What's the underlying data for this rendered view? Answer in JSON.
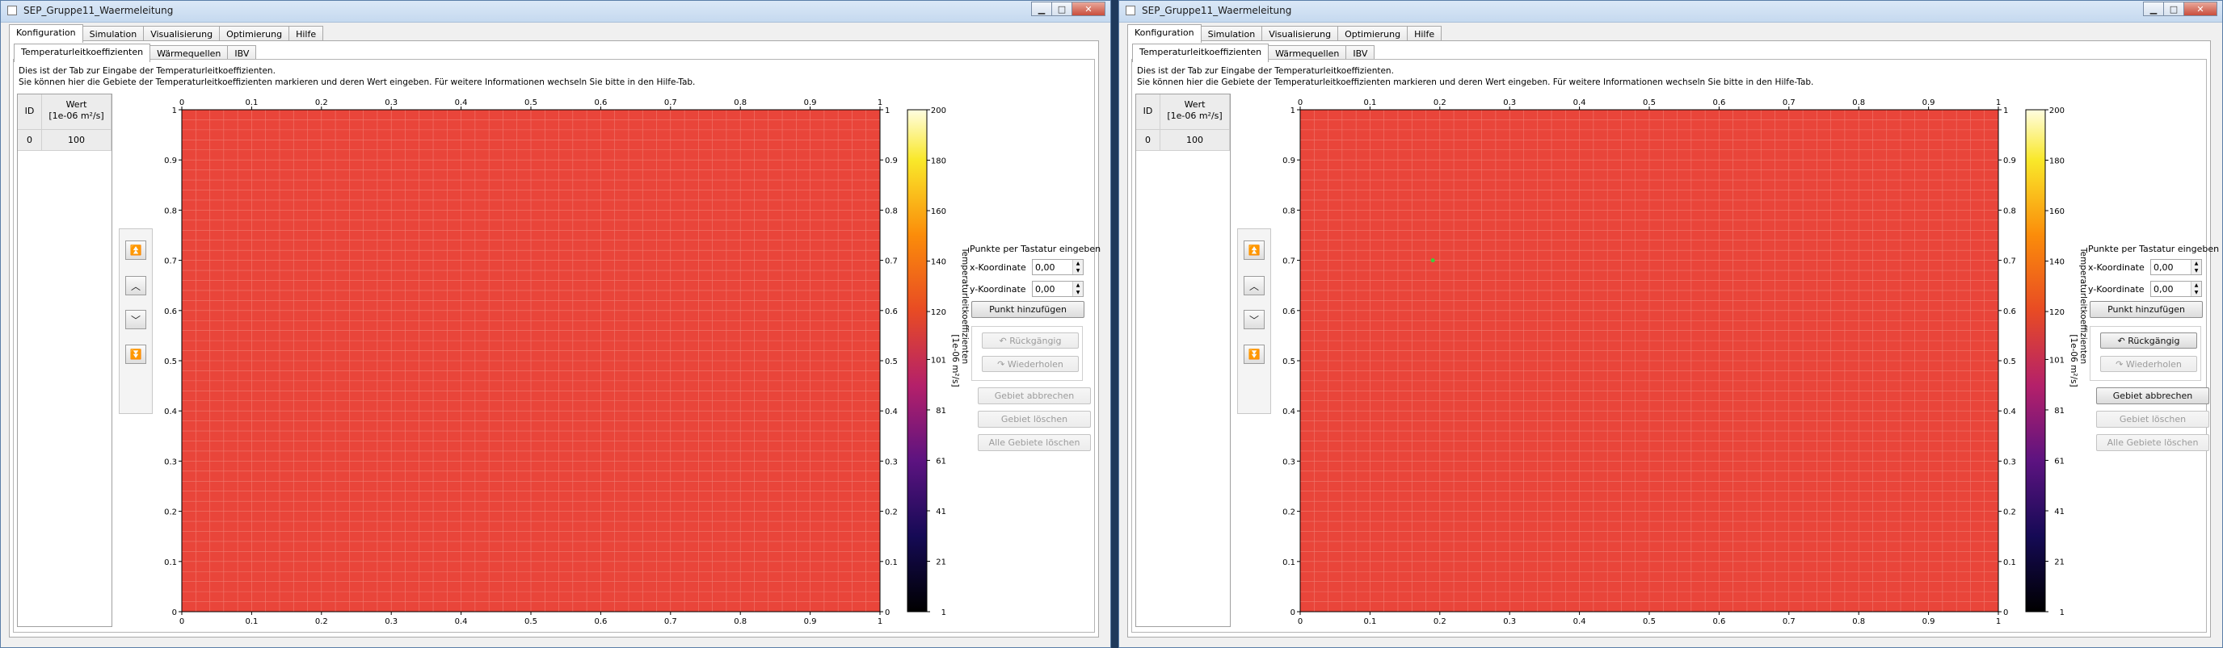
{
  "windows": [
    {
      "id": "left",
      "title": "SEP_Gruppe11_Waermeleitung",
      "main_tabs": [
        "Konfiguration",
        "Simulation",
        "Visualisierung",
        "Optimierung",
        "Hilfe"
      ],
      "active_main_tab": "Konfiguration",
      "sub_tabs": [
        "Temperaturleitkoeffizienten",
        "Wärmequellen",
        "IBV"
      ],
      "active_sub_tab": "Temperaturleitkoeffizienten",
      "description_line1": "Dies ist der Tab zur Eingabe der Temperaturleitkoeffizienten.",
      "description_line2": "Sie können hier die Gebiete der Temperaturleitkoeffizienten markieren und deren Wert eingeben. Für weitere Informationen wechseln Sie bitte in den Hilfe-Tab.",
      "table": {
        "col_id": "ID",
        "col_wert_line1": "Wert",
        "col_wert_line2": "[1e-06 m²/s]",
        "rows": [
          {
            "id": "0",
            "value": "100"
          }
        ]
      },
      "keyboard_title": "Punkte per Tastatur eingeben",
      "x_label": "x-Koordinate",
      "x_value": "0,00",
      "y_label": "y-Koordinate",
      "y_value": "0,00",
      "add_point_button": "Punkt hinzufügen",
      "undo_button": "Rückgängig",
      "redo_button": "Wiederholen",
      "cancel_area_button": "Gebiet abbrechen",
      "delete_area_button": "Gebiet löschen",
      "delete_all_button": "Alle Gebiete löschen",
      "undo_enabled": false,
      "cancel_area_enabled": false,
      "colorbar_label_line1": "Temperaturleitkoeffizienten",
      "colorbar_label_line2": "[1e-06 m²/s]",
      "marker": null
    },
    {
      "id": "right",
      "title": "SEP_Gruppe11_Waermeleitung",
      "main_tabs": [
        "Konfiguration",
        "Simulation",
        "Visualisierung",
        "Optimierung",
        "Hilfe"
      ],
      "active_main_tab": "Konfiguration",
      "sub_tabs": [
        "Temperaturleitkoeffizienten",
        "Wärmequellen",
        "IBV"
      ],
      "active_sub_tab": "Temperaturleitkoeffizienten",
      "description_line1": "Dies ist der Tab zur Eingabe der Temperaturleitkoeffizienten.",
      "description_line2": "Sie können hier die Gebiete der Temperaturleitkoeffizienten markieren und deren Wert eingeben. Für weitere Informationen wechseln Sie bitte in den Hilfe-Tab.",
      "table": {
        "col_id": "ID",
        "col_wert_line1": "Wert",
        "col_wert_line2": "[1e-06 m²/s]",
        "rows": [
          {
            "id": "0",
            "value": "100"
          }
        ]
      },
      "keyboard_title": "Punkte per Tastatur eingeben",
      "x_label": "x-Koordinate",
      "x_value": "0,00",
      "y_label": "y-Koordinate",
      "y_value": "0,00",
      "add_point_button": "Punkt hinzufügen",
      "undo_button": "Rückgängig",
      "redo_button": "Wiederholen",
      "cancel_area_button": "Gebiet abbrechen",
      "delete_area_button": "Gebiet löschen",
      "delete_all_button": "Alle Gebiete löschen",
      "undo_enabled": true,
      "cancel_area_enabled": true,
      "colorbar_label_line1": "Temperaturleitkoeffizienten",
      "colorbar_label_line2": "[1e-06 m²/s]",
      "marker": {
        "x": 0.19,
        "y": 0.7
      }
    }
  ],
  "chart_data": {
    "type": "heatmap",
    "x_ticks": [
      "0",
      "0.1",
      "0.2",
      "0.3",
      "0.4",
      "0.5",
      "0.6",
      "0.7",
      "0.8",
      "0.9",
      "1"
    ],
    "y_ticks": [
      "0",
      "0.1",
      "0.2",
      "0.3",
      "0.4",
      "0.5",
      "0.6",
      "0.7",
      "0.8",
      "0.9",
      "1"
    ],
    "xlim": [
      0,
      1
    ],
    "ylim": [
      0,
      1
    ],
    "field_value": 100,
    "field_color": "#e9453a",
    "colorbar_ticks": [
      "1",
      "21",
      "41",
      "61",
      "81",
      "101",
      "120",
      "140",
      "160",
      "180",
      "200"
    ],
    "colorbar_range": [
      1,
      200
    ],
    "marker_color": "#3dcc3d"
  }
}
